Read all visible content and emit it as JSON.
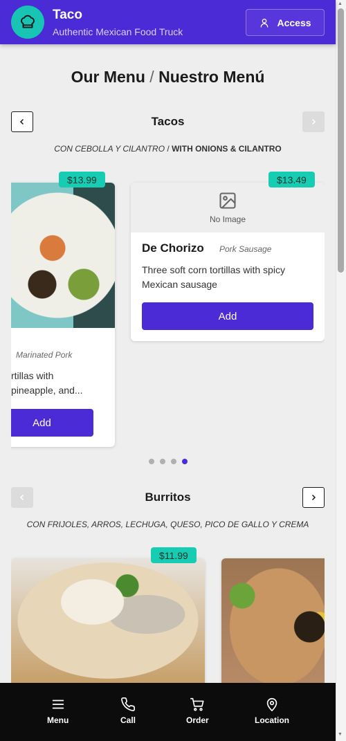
{
  "header": {
    "brand_name": "Taco",
    "brand_subtitle": "Authentic Mexican Food Truck",
    "access_label": "Access"
  },
  "menu": {
    "title_es": "Our Menu",
    "separator": "/",
    "title_en": "Nuestro Menú"
  },
  "sections": [
    {
      "title": "Tacos",
      "note_es": "CON CEBOLLA Y CILANTRO",
      "note_sep": "/",
      "note_en": "WITH ONIONS & CILANTRO",
      "items": [
        {
          "price": "$13.99",
          "subtitle": "Marinated Pork",
          "description": "rtillas with pineapple, and...",
          "add_label": "Add"
        },
        {
          "price": "$13.49",
          "image_placeholder": "No Image",
          "name": "De Chorizo",
          "subtitle": "Pork Sausage",
          "description": "Three soft corn tortillas with spicy Mexican sausage",
          "add_label": "Add"
        }
      ],
      "pager": {
        "count": 4,
        "active": 4
      }
    },
    {
      "title": "Burritos",
      "note": "CON FRIJOLES, ARROS, LECHUGA, QUESO, PICO DE GALLO Y CREMA",
      "items": [
        {
          "price": "$11.99"
        }
      ]
    }
  ],
  "bottom_nav": [
    {
      "label": "Menu",
      "icon": "menu-icon"
    },
    {
      "label": "Call",
      "icon": "phone-icon"
    },
    {
      "label": "Order",
      "icon": "cart-icon"
    },
    {
      "label": "Location",
      "icon": "map-pin-icon"
    }
  ],
  "colors": {
    "primary": "#4a2bd6",
    "accent": "#16cdb4",
    "background": "#eeeeee",
    "nav_background": "#0c0c0c"
  }
}
